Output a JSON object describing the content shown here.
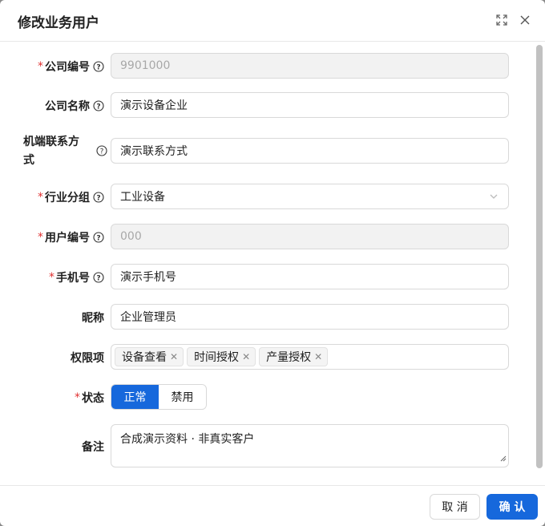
{
  "dialog": {
    "title": "修改业务用户",
    "expand_icon": "expand-icon",
    "close_icon": "close-icon"
  },
  "form": {
    "company_code": {
      "label": "公司编号",
      "required": true,
      "value": "9901000",
      "disabled": true
    },
    "company_name": {
      "label": "公司名称",
      "required": false,
      "value": "演示设备企业"
    },
    "contact": {
      "label_line1": "机端联系方",
      "label_line2": "式",
      "required": false,
      "value": "演示联系方式"
    },
    "industry_group": {
      "label": "行业分组",
      "required": true,
      "value": "工业设备"
    },
    "user_code": {
      "label": "用户编号",
      "required": true,
      "value": "000",
      "disabled": true
    },
    "phone": {
      "label": "手机号",
      "required": true,
      "value": "演示手机号"
    },
    "nickname": {
      "label": "昵称",
      "required": false,
      "value": "企业管理员"
    },
    "permissions": {
      "label": "权限项",
      "tags": [
        "设备查看",
        "时间授权",
        "产量授权"
      ]
    },
    "status": {
      "label": "状态",
      "required": true,
      "options": [
        "正常",
        "禁用"
      ],
      "selected": "正常"
    },
    "remark": {
      "label": "备注",
      "value": "合成演示资料 · 非真实客户"
    }
  },
  "footer": {
    "cancel_label": "取 消",
    "ok_label": "确 认"
  },
  "colors": {
    "primary": "#1668dc",
    "required": "#e03131"
  }
}
